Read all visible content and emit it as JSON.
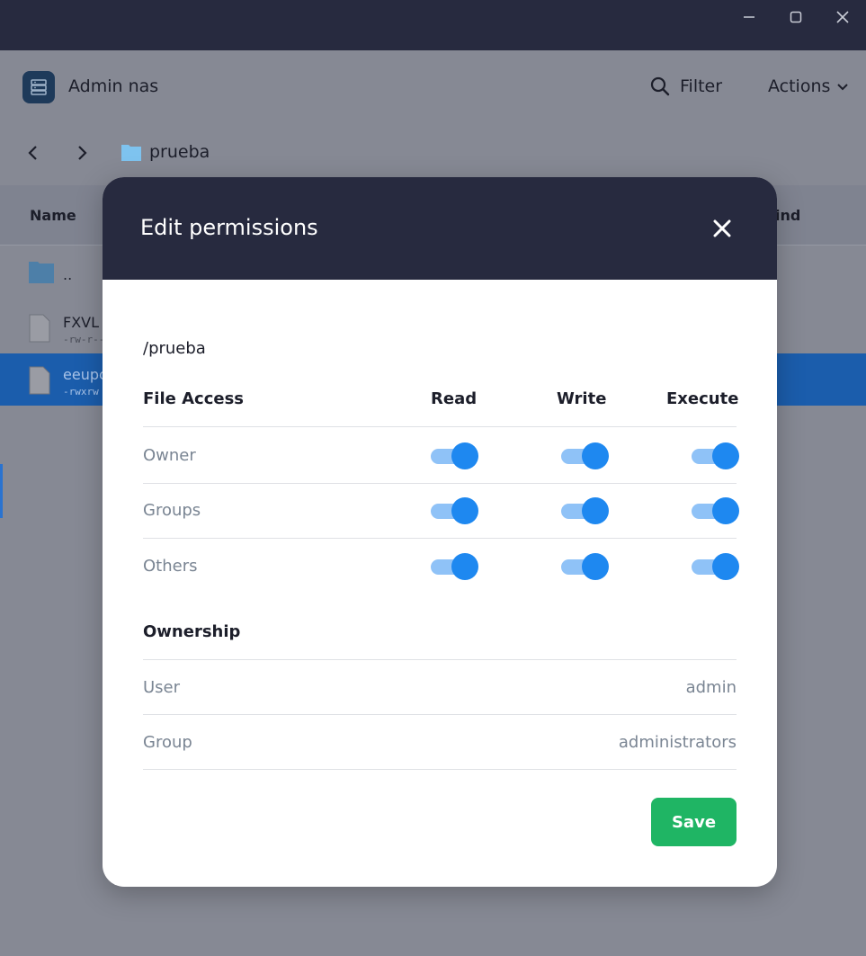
{
  "app": {
    "title": "Admin nas",
    "filter_label": "Filter",
    "actions_label": "Actions"
  },
  "breadcrumb": {
    "folder": "prueba"
  },
  "table": {
    "col_name": "Name",
    "col_kind": "ind",
    "rows": [
      {
        "name": "..",
        "perm": ""
      },
      {
        "name": "FXVL",
        "perm": "-rw-r--"
      },
      {
        "name": "eeupc",
        "perm": "-rwxrw"
      }
    ]
  },
  "modal": {
    "title": "Edit permissions",
    "path": "/prueba",
    "file_access_label": "File Access",
    "col_read": "Read",
    "col_write": "Write",
    "col_execute": "Execute",
    "permissions": [
      {
        "label": "Owner",
        "read": true,
        "write": true,
        "execute": true
      },
      {
        "label": "Groups",
        "read": true,
        "write": true,
        "execute": true
      },
      {
        "label": "Others",
        "read": true,
        "write": true,
        "execute": true
      }
    ],
    "ownership_label": "Ownership",
    "ownership": [
      {
        "label": "User",
        "value": "admin"
      },
      {
        "label": "Group",
        "value": "administrators"
      }
    ],
    "save_label": "Save"
  },
  "colors": {
    "accent": "#1e88f0",
    "save": "#1fb564",
    "header": "#272a3f"
  }
}
